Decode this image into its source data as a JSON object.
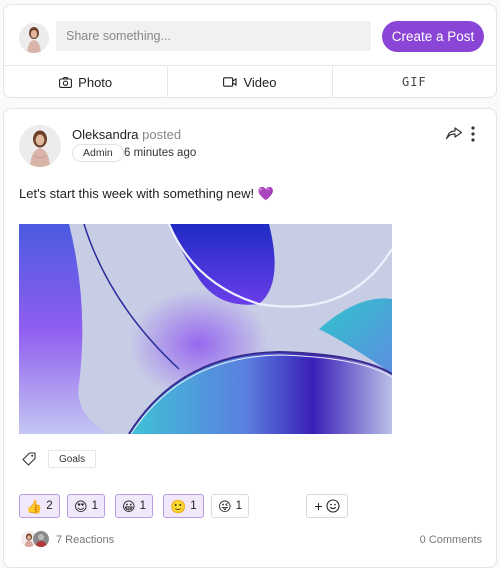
{
  "composer": {
    "placeholder": "Share something...",
    "create_button": "Create a Post",
    "actions": [
      {
        "label": "Photo",
        "icon": "camera-icon"
      },
      {
        "label": "Video",
        "icon": "video-icon"
      },
      {
        "label": "GIF",
        "icon": null
      }
    ]
  },
  "post": {
    "author": "Oleksandra",
    "verb": "posted",
    "role": "Admin",
    "timestamp": "6 minutes ago",
    "text": "Let's start this week with something new! 💜",
    "image_alt": "Abstract purple and blue glass shapes",
    "tags": [
      "Goals"
    ],
    "reactions": [
      {
        "emoji": "👍",
        "name": "thumbs-up",
        "count": "2",
        "selected": true
      },
      {
        "emoji": "😍",
        "name": "heart-eyes",
        "count": "1",
        "selected": true
      },
      {
        "emoji": "😀",
        "name": "grinning",
        "count": "1",
        "selected": true
      },
      {
        "emoji": "🙂",
        "name": "smiley",
        "count": "1",
        "selected": true
      },
      {
        "emoji": "😜",
        "name": "winking-tongue",
        "count": "1",
        "selected": false
      }
    ],
    "add_reaction_label": "+",
    "reactions_summary": "7 Reactions",
    "comments_summary": "0 Comments"
  },
  "colors": {
    "accent": "#8a45d6",
    "reaction_selected_bg": "#f1e9fb",
    "reaction_selected_border": "#b89be0"
  }
}
